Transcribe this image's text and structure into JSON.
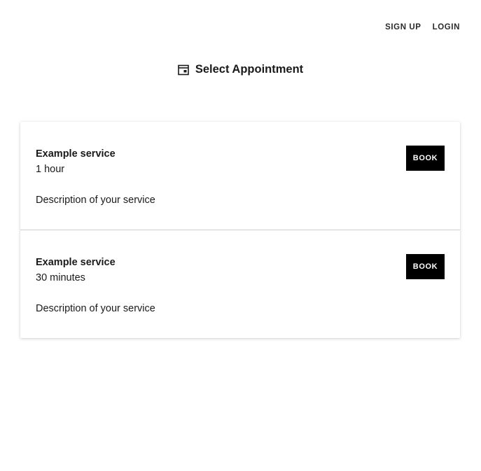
{
  "nav": {
    "signup_label": "SIGN UP",
    "login_label": "LOGIN"
  },
  "header": {
    "icon": "calendar-icon",
    "title": "Select Appointment"
  },
  "services": [
    {
      "name": "Example service",
      "duration": "1 hour",
      "description": "Description of your service",
      "button_label": "BOOK"
    },
    {
      "name": "Example service",
      "duration": "30 minutes",
      "description": "Description of your service",
      "button_label": "BOOK"
    }
  ],
  "colors": {
    "button_bg": "#000000",
    "button_text": "#ffffff",
    "text": "#1a1a1a",
    "divider": "#cfcfcf"
  }
}
